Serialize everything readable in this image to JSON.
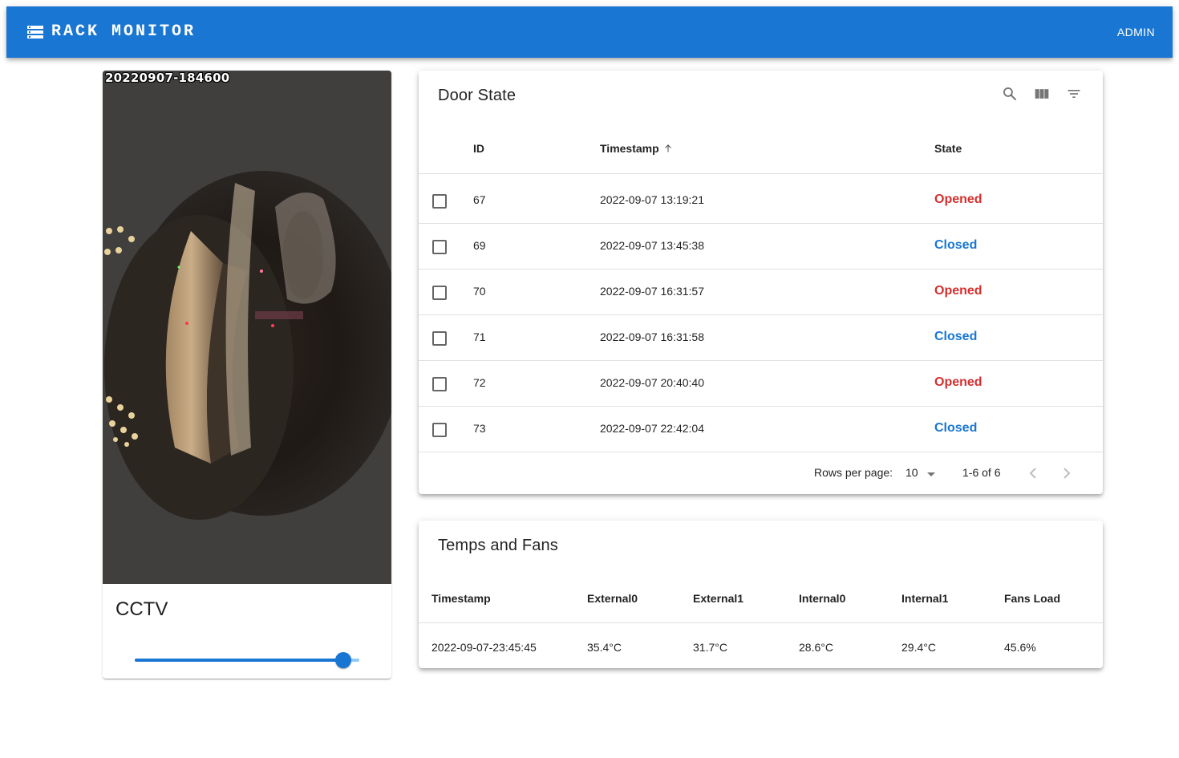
{
  "app": {
    "title": "RACK MONITOR",
    "admin_label": "ADMIN",
    "colors": {
      "primary": "#1976d2",
      "opened": "#d32f2f",
      "closed": "#1976d2"
    }
  },
  "cctv": {
    "timestamp_overlay": "20220907-184600",
    "title": "CCTV",
    "slider_value_percent": 93
  },
  "door_state": {
    "title": "Door State",
    "toolbar_icons": [
      "search-icon",
      "view-column-icon",
      "filter-list-icon"
    ],
    "columns": {
      "id": "ID",
      "timestamp": "Timestamp",
      "state": "State"
    },
    "rows": [
      {
        "id": "67",
        "timestamp": "2022-09-07 13:19:21",
        "state": "Opened"
      },
      {
        "id": "69",
        "timestamp": "2022-09-07 13:45:38",
        "state": "Closed"
      },
      {
        "id": "70",
        "timestamp": "2022-09-07 16:31:57",
        "state": "Opened"
      },
      {
        "id": "71",
        "timestamp": "2022-09-07 16:31:58",
        "state": "Closed"
      },
      {
        "id": "72",
        "timestamp": "2022-09-07 20:40:40",
        "state": "Opened"
      },
      {
        "id": "73",
        "timestamp": "2022-09-07 22:42:04",
        "state": "Closed"
      }
    ],
    "pagination": {
      "rows_per_page_label": "Rows per page:",
      "rows_per_page": "10",
      "range": "1-6 of 6"
    }
  },
  "temps": {
    "title": "Temps and Fans",
    "columns": [
      "Timestamp",
      "External0",
      "External1",
      "Internal0",
      "Internal1",
      "Fans Load"
    ],
    "row": [
      "2022-09-07-23:45:45",
      "35.4°C",
      "31.7°C",
      "28.6°C",
      "29.4°C",
      "45.6%"
    ]
  }
}
